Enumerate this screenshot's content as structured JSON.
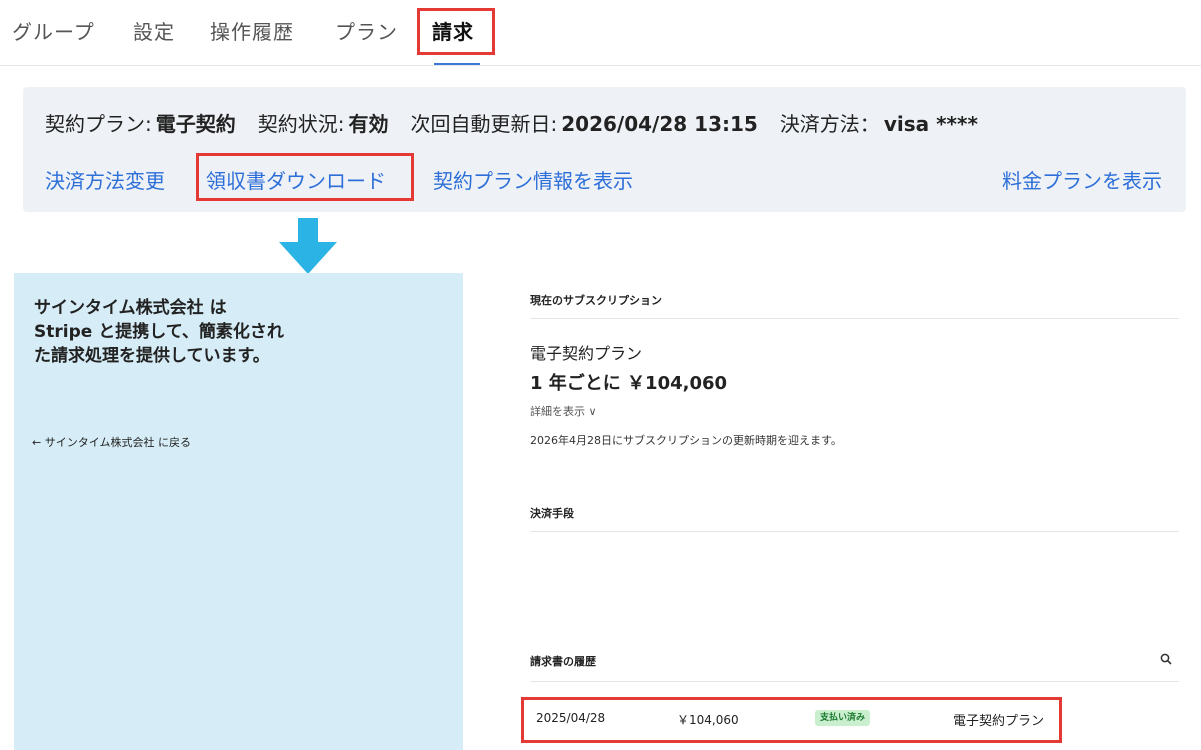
{
  "tabs": [
    {
      "label": "グループ"
    },
    {
      "label": "設定"
    },
    {
      "label": "操作履歴"
    },
    {
      "label": "プラン"
    },
    {
      "label": "請求",
      "active": true
    }
  ],
  "contract": {
    "plan_label": "契約プラン:",
    "plan_value": "電子契約",
    "status_label": "契約状況:",
    "status_value": "有効",
    "renewal_label": "次回自動更新日:",
    "renewal_value": "2026/04/28 13:15",
    "payment_label": "決済方法：",
    "payment_value": "visa ****"
  },
  "actions": {
    "change_payment": "決済方法変更",
    "download_receipt": "領収書ダウンロード",
    "show_plan_info": "契約プラン情報を表示",
    "show_pricing": "料金プランを表示"
  },
  "colors": {
    "highlight": "#e53935",
    "link": "#2d6fd8",
    "arrow": "#2bb3e6",
    "portal_left_bg": "#d6ecf6",
    "paid_badge_bg": "#c9efcf"
  },
  "portal": {
    "left": {
      "title": "サインタイム株式会社 は Stripe と提携して、簡素化された請求処理を提供しています。",
      "back_link": "← サインタイム株式会社 に戻る"
    },
    "subscription": {
      "section_title": "現在のサブスクリプション",
      "plan_name": "電子契約プラン",
      "price": "1 年ごとに ￥104,060",
      "details_link": "詳細を表示 ∨",
      "renewal_note": "2026年4月28日にサブスクリプションの更新時期を迎えます。"
    },
    "payment_method": {
      "section_title": "決済手段"
    },
    "invoices": {
      "section_title": "請求書の履歴",
      "search_icon": "search-icon",
      "rows": [
        {
          "date": "2025/04/28",
          "amount": "￥104,060",
          "status": "支払い済み",
          "plan": "電子契約プラン"
        }
      ]
    }
  }
}
